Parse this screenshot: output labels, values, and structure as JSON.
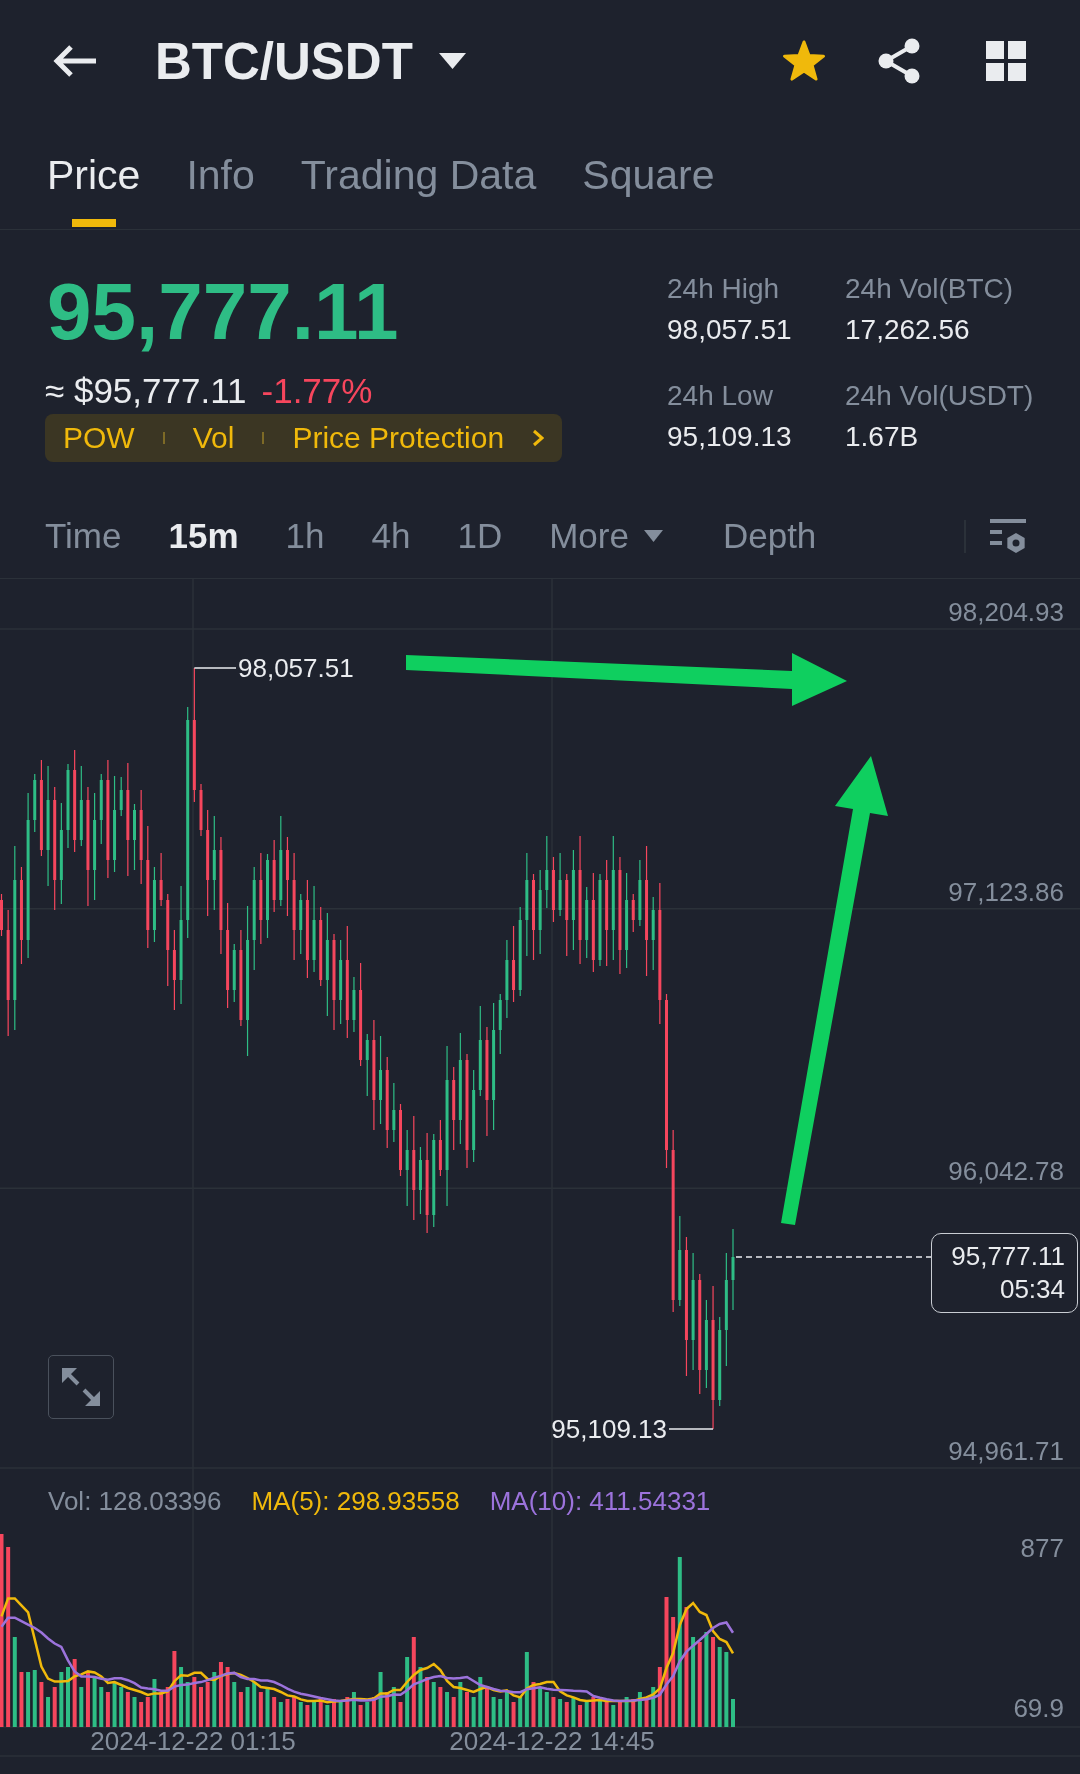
{
  "header": {
    "title": "BTC/USDT",
    "favorite": true
  },
  "tabs": [
    {
      "label": "Price",
      "selected": true
    },
    {
      "label": "Info",
      "selected": false
    },
    {
      "label": "Trading Data",
      "selected": false
    },
    {
      "label": "Square",
      "selected": false
    }
  ],
  "price": {
    "last": "95,777.11",
    "approx": "≈ $95,777.11",
    "change": "-1.77%"
  },
  "tags": [
    "POW",
    "Vol",
    "Price Protection"
  ],
  "stats": [
    {
      "label": "24h High",
      "value": "98,057.51"
    },
    {
      "label": "24h Vol(BTC)",
      "value": "17,262.56"
    },
    {
      "label": "24h Low",
      "value": "95,109.13"
    },
    {
      "label": "24h Vol(USDT)",
      "value": "1.67B"
    }
  ],
  "intervals": [
    {
      "label": "Time",
      "kind": "option",
      "selected": false
    },
    {
      "label": "15m",
      "kind": "option",
      "selected": true
    },
    {
      "label": "1h",
      "kind": "option",
      "selected": false
    },
    {
      "label": "4h",
      "kind": "option",
      "selected": false
    },
    {
      "label": "1D",
      "kind": "option",
      "selected": false
    },
    {
      "label": "More",
      "kind": "menu",
      "selected": false
    },
    {
      "label": "Depth",
      "kind": "view",
      "selected": false
    }
  ],
  "chart": {
    "price_axis": [
      "98,204.93",
      "97,123.86",
      "96,042.78",
      "94,961.71"
    ],
    "high": "98,057.51",
    "low": "95,109.13",
    "last_price": "95,777.11",
    "countdown": "05:34"
  },
  "volume": {
    "legend": [
      {
        "label": "Vol: 128.03396",
        "color": "#848e9c"
      },
      {
        "label": "MA(5): 298.93558",
        "color": "#f0b90b"
      },
      {
        "label": "MA(10): 411.54331",
        "color": "#9c73dc"
      }
    ],
    "axis": [
      "877",
      "69.9"
    ],
    "time_axis": [
      "2024-12-22 01:15",
      "2024-12-22 14:45"
    ]
  }
}
